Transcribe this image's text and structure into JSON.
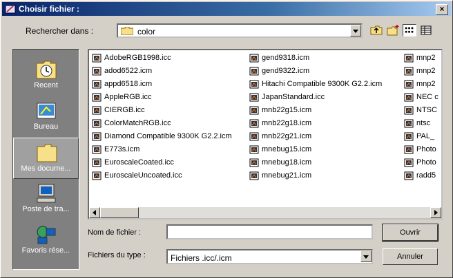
{
  "window": {
    "title": "Choisir fichier :"
  },
  "lookin": {
    "label": "Rechercher dans :",
    "folder": "color"
  },
  "places": [
    {
      "label": "Recent",
      "icon": "recent-icon"
    },
    {
      "label": "Bureau",
      "icon": "desktop-icon"
    },
    {
      "label": "Mes docume...",
      "icon": "my-documents-icon"
    },
    {
      "label": "Poste de tra...",
      "icon": "my-computer-icon"
    },
    {
      "label": "Favoris rése...",
      "icon": "network-places-icon"
    }
  ],
  "files": {
    "col1": [
      "AdobeRGB1998.icc",
      "adod6522.icm",
      "appd6518.icm",
      "AppleRGB.icc",
      "CIERGB.icc",
      "ColorMatchRGB.icc",
      "Diamond Compatible 9300K G2.2.icm",
      "E773s.icm",
      "EuroscaleCoated.icc",
      "EuroscaleUncoated.icc"
    ],
    "col2": [
      "gend9318.icm",
      "gend9322.icm",
      "Hitachi Compatible 9300K G2.2.icm",
      "JapanStandard.icc",
      "mnb22g15.icm",
      "mnb22g18.icm",
      "mnb22g21.icm",
      "mnebug15.icm",
      "mnebug18.icm",
      "mnebug21.icm"
    ],
    "col3": [
      "mnp2",
      "mnp2",
      "mnp2",
      "NEC c",
      "NTSC",
      "ntsc",
      "PAL_",
      "Photo",
      "Photo",
      "radd5"
    ]
  },
  "form": {
    "name_label": "Nom de fichier :",
    "name_value": "",
    "type_label": "Fichiers du type :",
    "type_value": "Fichiers .icc/.icm"
  },
  "buttons": {
    "open": "Ouvrir",
    "cancel": "Annuler"
  }
}
